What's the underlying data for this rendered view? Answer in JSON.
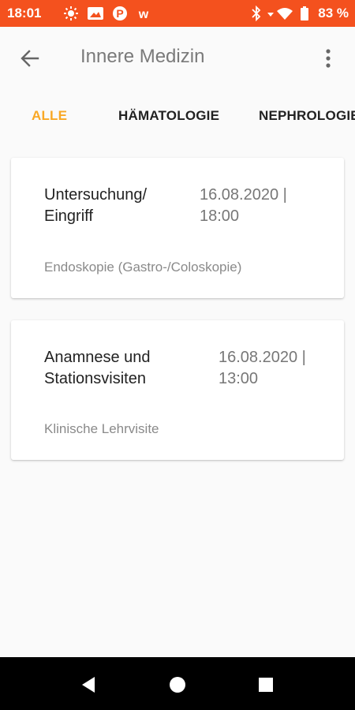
{
  "status_bar": {
    "time": "18:01",
    "battery_percent": "83 %",
    "left_icons": [
      "weather-icon",
      "gallery-icon",
      "app-p-icon",
      "app-w-icon"
    ],
    "right_icons": [
      "bluetooth-icon",
      "data-arrow-icon",
      "wifi-icon",
      "battery-icon"
    ]
  },
  "app_bar": {
    "title": "Innere Medizin"
  },
  "tabs": [
    {
      "label": "ALLE",
      "active": true
    },
    {
      "label": "HÄMATOLOGIE",
      "active": false
    },
    {
      "label": "NEPHROLOGIE",
      "active": false
    }
  ],
  "cards": [
    {
      "title_line1": "Untersuchung/",
      "title_line2": "Eingriff",
      "date_line1": "16.08.2020 |",
      "date_line2": "18:00",
      "subtitle": "Endoskopie (Gastro-/Coloskopie)"
    },
    {
      "title_line1": "Anamnese und",
      "title_line2": "Stationsvisiten",
      "date_line1": "16.08.2020 |",
      "date_line2": "13:00",
      "subtitle": "Klinische Lehrvisite"
    }
  ],
  "colors": {
    "status_bar": "#f4511e",
    "tab_active": "#f9a825",
    "background": "#fafafa",
    "nav_bar": "#000000"
  }
}
